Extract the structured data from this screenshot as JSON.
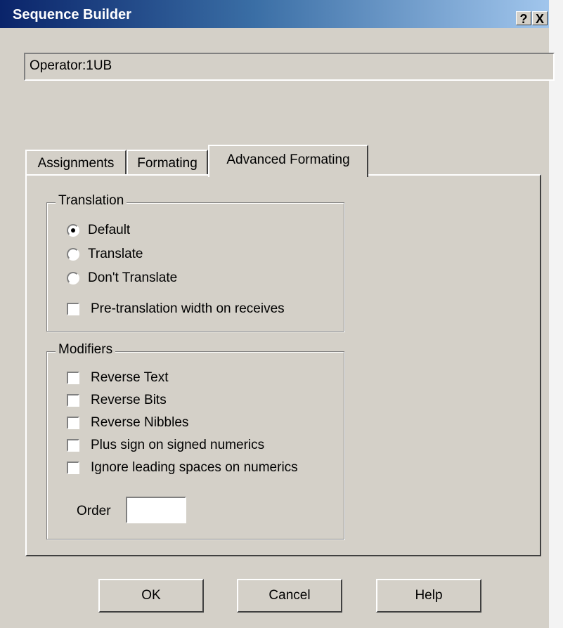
{
  "window": {
    "title": "Sequence Builder",
    "help_button": "?",
    "close_button": "X"
  },
  "operator_field": {
    "value": "Operator:1UB"
  },
  "tabs": [
    {
      "label": "Assignments",
      "active": false
    },
    {
      "label": "Formating",
      "active": false
    },
    {
      "label": "Advanced Formating",
      "active": true
    }
  ],
  "translation": {
    "legend": "Translation",
    "options": [
      {
        "label": "Default",
        "selected": true
      },
      {
        "label": "Translate",
        "selected": false
      },
      {
        "label": "Don't Translate",
        "selected": false
      }
    ],
    "pretranslation_label": "Pre-translation width on receives",
    "pretranslation_checked": false
  },
  "modifiers": {
    "legend": "Modifiers",
    "items": [
      {
        "label": "Reverse Text",
        "checked": false
      },
      {
        "label": "Reverse Bits",
        "checked": false
      },
      {
        "label": "Reverse Nibbles",
        "checked": false
      },
      {
        "label": "Plus sign on signed numerics",
        "checked": false
      },
      {
        "label": "Ignore leading spaces on numerics",
        "checked": false
      }
    ],
    "order_label": "Order",
    "order_value": ""
  },
  "buttons": {
    "ok": "OK",
    "cancel": "Cancel",
    "help": "Help"
  },
  "colors": {
    "titlebar_start": "#0a246a",
    "titlebar_end": "#a6caf0",
    "dialog_bg": "#d4d0c8"
  }
}
